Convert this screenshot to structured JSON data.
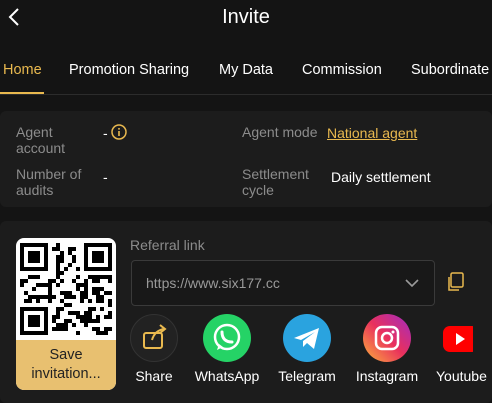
{
  "header": {
    "title": "Invite"
  },
  "tabs": [
    {
      "label": "Home"
    },
    {
      "label": "Promotion Sharing"
    },
    {
      "label": "My Data"
    },
    {
      "label": "Commission"
    },
    {
      "label": "Subordinate"
    }
  ],
  "info": {
    "agent_account_label": "Agent account",
    "agent_account_value": "-",
    "agent_mode_label": "Agent mode",
    "agent_mode_value": "National agent",
    "audits_label": "Number of audits",
    "audits_value": "-",
    "settlement_label": "Settlement cycle",
    "settlement_value": "Daily settlement"
  },
  "invite": {
    "save_label_1": "Save",
    "save_label_2": "invitation...",
    "referral_label": "Referral link",
    "referral_value": "https://www.six177.cc"
  },
  "share": [
    {
      "label": "Share",
      "icon": "share-icon",
      "color": "#222222"
    },
    {
      "label": "WhatsApp",
      "icon": "whatsapp-icon",
      "color": "#25d366"
    },
    {
      "label": "Telegram",
      "icon": "telegram-icon",
      "color": "#2aa3df"
    },
    {
      "label": "Instagram",
      "icon": "instagram-icon",
      "color": "#e1306c"
    },
    {
      "label": "Youtube",
      "icon": "youtube-icon",
      "color": "#ff0000"
    }
  ],
  "colors": {
    "accent": "#e9b94f",
    "background": "#141414",
    "card": "#1c1c1c"
  }
}
